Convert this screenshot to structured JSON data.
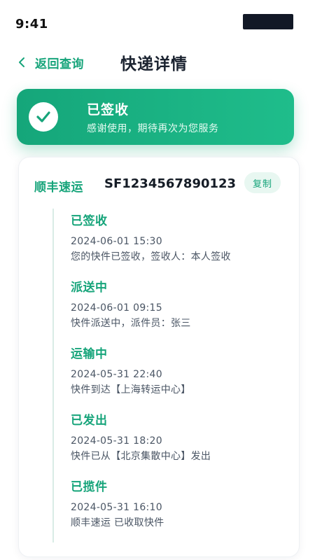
{
  "status_bar": {
    "time": "9:41"
  },
  "header": {
    "back_label": "返回查询",
    "title": "快递详情"
  },
  "banner": {
    "title": "已签收",
    "subtitle": "感谢使用，期待再次为您服务"
  },
  "shipment": {
    "carrier": "顺丰速运",
    "tracking_number": "SF1234567890123",
    "copy_label": "复制"
  },
  "timeline": [
    {
      "status": "已签收",
      "time": "2024-06-01 15:30",
      "description": "您的快件已签收，签收人：本人签收"
    },
    {
      "status": "派送中",
      "time": "2024-06-01 09:15",
      "description": "快件派送中，派件员：张三"
    },
    {
      "status": "运输中",
      "time": "2024-05-31 22:40",
      "description": "快件到达【上海转运中心】"
    },
    {
      "status": "已发出",
      "time": "2024-05-31 18:20",
      "description": "快件已从【北京集散中心】发出"
    },
    {
      "status": "已揽件",
      "time": "2024-05-31 16:10",
      "description": "顺丰速运 已收取快件"
    }
  ],
  "colors": {
    "accent": "#16a47a",
    "banner_start": "#15a67a",
    "banner_end": "#1fbd8b",
    "title_text": "#1b2330",
    "secondary_text": "#4a5564"
  },
  "icons": {
    "back": "chevron-left-icon",
    "banner": "check-circle-icon"
  }
}
